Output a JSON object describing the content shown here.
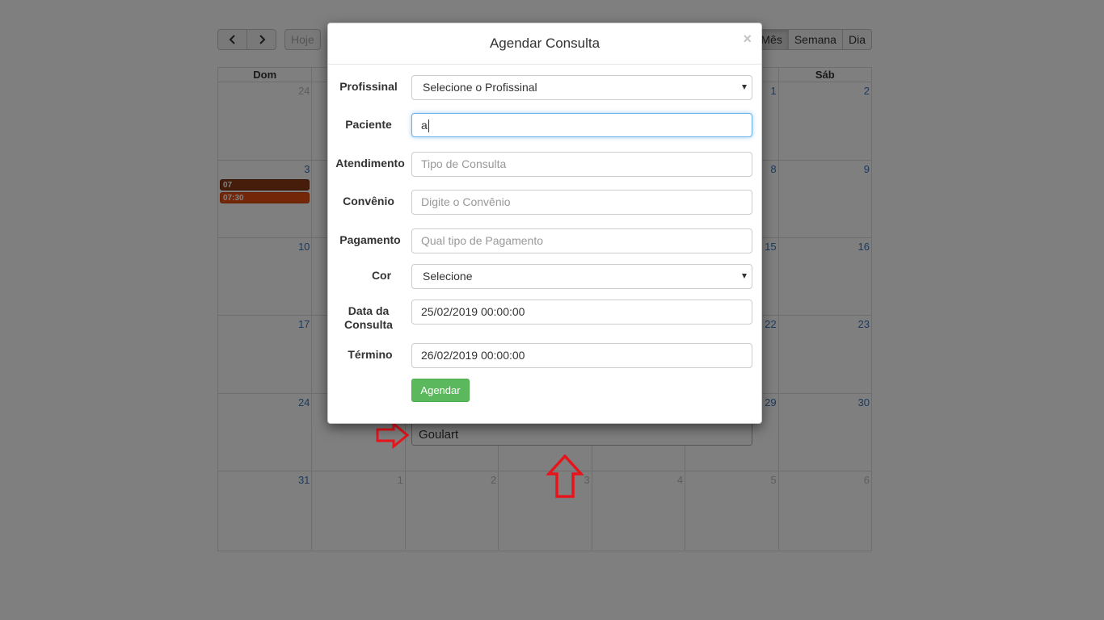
{
  "toolbar": {
    "today_label": "Hoje",
    "views": [
      "Mês",
      "Semana",
      "Dia"
    ],
    "active_view": "Mês"
  },
  "calendar": {
    "weekdays": [
      "Dom",
      "",
      "",
      "",
      "",
      "",
      "Sáb"
    ],
    "weeks": [
      [
        "24",
        "",
        "",
        "",
        "",
        "1",
        "2"
      ],
      [
        "3",
        "",
        "",
        "",
        "",
        "8",
        "9"
      ],
      [
        "10",
        "",
        "",
        "",
        "",
        "15",
        "16"
      ],
      [
        "17",
        "",
        "",
        "",
        "",
        "22",
        "23"
      ],
      [
        "24",
        "",
        "",
        "",
        "",
        "29",
        "30"
      ],
      [
        "31",
        "1",
        "2",
        "3",
        "4",
        "5",
        "6"
      ]
    ],
    "events": [
      {
        "label": "07",
        "color": "#8a3a14"
      },
      {
        "label": "07:30",
        "color": "#e84e10"
      }
    ]
  },
  "autocomplete": {
    "suggestion": "Goulart"
  },
  "modal": {
    "title": "Agendar Consulta",
    "close_label": "×",
    "fields": {
      "profissional": {
        "label": "Profissinal",
        "value": "Selecione o Profissinal"
      },
      "paciente": {
        "label": "Paciente",
        "value": "a"
      },
      "atendimento": {
        "label": "Atendimento",
        "placeholder": "Tipo de Consulta"
      },
      "convenio": {
        "label": "Convênio",
        "placeholder": "Digite o Convênio"
      },
      "pagamento": {
        "label": "Pagamento",
        "placeholder": "Qual tipo de Pagamento"
      },
      "cor": {
        "label": "Cor",
        "value": "Selecione"
      },
      "data": {
        "label_line1": "Data da",
        "label_line2": "Consulta",
        "value": "25/02/2019 00:00:00"
      },
      "termino": {
        "label": "Término",
        "value": "26/02/2019 00:00:00"
      }
    },
    "submit_label": "Agendar",
    "submit_color": "#5cb85c"
  },
  "annotation_color": "#e8141c"
}
